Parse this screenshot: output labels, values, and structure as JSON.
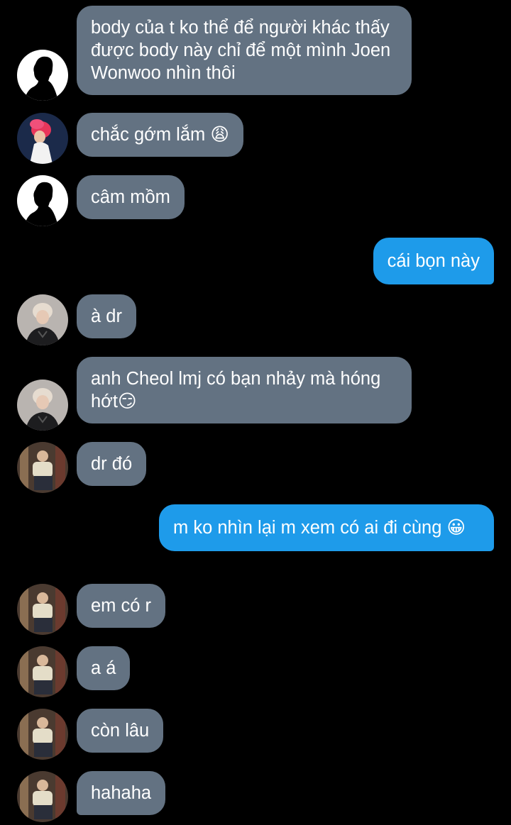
{
  "messages": [
    {
      "dir": "in",
      "avatar": "silhouette",
      "text": "body của t ko thể để người khác thấy được body này chỉ để một mình Joen Wonwoo nhìn thôi"
    },
    {
      "dir": "in",
      "avatar": "pink-hair",
      "text": "chắc gớm lắm 😩"
    },
    {
      "dir": "in",
      "avatar": "silhouette",
      "text": "câm mồm"
    },
    {
      "dir": "out",
      "text": "cái bọn này"
    },
    {
      "dir": "in",
      "avatar": "blond-boy",
      "text": "à dr"
    },
    {
      "dir": "in",
      "avatar": "blond-boy",
      "text": "anh Cheol lmj có bạn nhảy mà hóng hớt😏"
    },
    {
      "dir": "in",
      "avatar": "seated-man",
      "text": "dr đó"
    },
    {
      "dir": "out",
      "text": "m ko nhìn lại m xem có ai đi cùng 😀"
    },
    {
      "dir": "in",
      "avatar": "seated-man",
      "text": "em có r"
    },
    {
      "dir": "in",
      "avatar": "seated-man",
      "text": "a á"
    },
    {
      "dir": "in",
      "avatar": "seated-man",
      "text": "còn lâu"
    },
    {
      "dir": "in",
      "avatar": "seated-man",
      "text": "hahaha"
    }
  ],
  "colors": {
    "background": "#000000",
    "incoming_bubble": "#637282",
    "outgoing_bubble": "#1e9bea",
    "text": "#ffffff"
  }
}
